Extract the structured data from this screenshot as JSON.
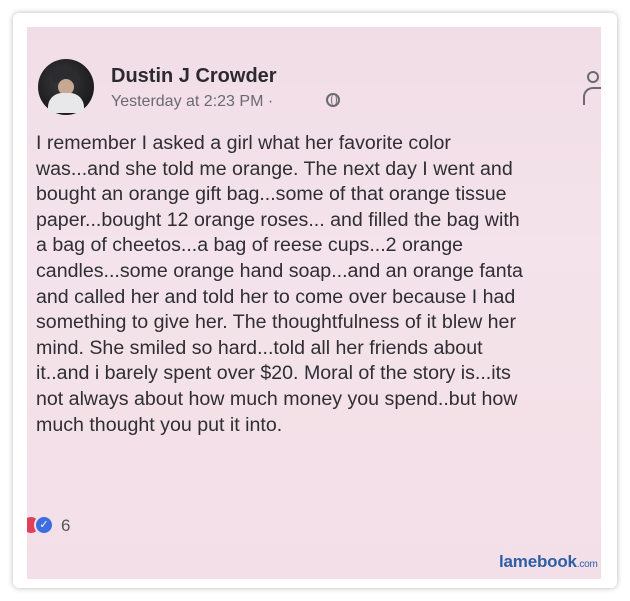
{
  "post": {
    "author": "Dustin J Crowder",
    "timestamp": "Yesterday at 2:23 PM ·",
    "privacy_icon": "globe-icon",
    "body_lines": [
      "I remember I asked a girl what her favorite color",
      "was...and she told me orange. The next day I went and",
      "bought an orange gift bag...some of that orange tissue",
      "paper...bought 12 orange roses... and filled the bag with",
      "a bag of cheetos...a bag of reese cups...2 orange",
      "candles...some orange hand soap...and an orange fanta",
      "and called her and told her to come over because I had",
      "something to give her. The thoughtfulness of it blew her",
      "mind. She smiled so hard...told all her friends about",
      "it..and i barely spent over $20. Moral of the story is...its",
      "not always about how much money you spend..but how",
      "much thought you put it into."
    ],
    "reaction_count": "6",
    "reactions": [
      "love",
      "like"
    ]
  },
  "watermark": {
    "brand": "lamebook",
    "suffix": ".com"
  },
  "colors": {
    "background": "#f3dfe7",
    "text": "#2e2e33",
    "love": "#e0405c",
    "like": "#3b6fe0",
    "watermark": "#2d5fa8"
  }
}
